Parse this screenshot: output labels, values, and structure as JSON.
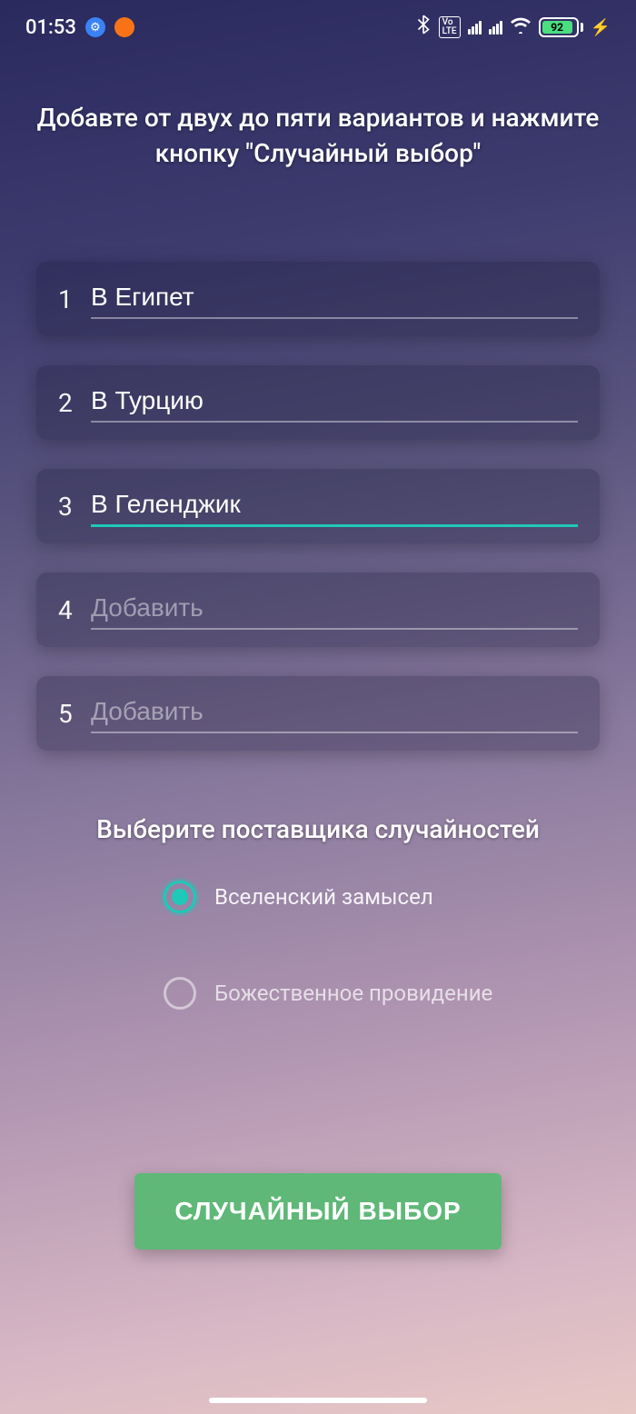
{
  "status": {
    "time": "01:53",
    "battery_pct": "92"
  },
  "instruction": "Добавте от двух до пяти вариантов и нажмите кнопку \"Случайный выбор\"",
  "options": [
    {
      "num": "1",
      "value": "В Египет",
      "placeholder": "",
      "active": false
    },
    {
      "num": "2",
      "value": "В Турцию",
      "placeholder": "",
      "active": false
    },
    {
      "num": "3",
      "value": "В Геленджик",
      "placeholder": "",
      "active": true
    },
    {
      "num": "4",
      "value": "",
      "placeholder": "Добавить",
      "active": false
    },
    {
      "num": "5",
      "value": "",
      "placeholder": "Добавить",
      "active": false
    }
  ],
  "provider_title": "Выберите поставщика случайностей",
  "providers": [
    {
      "label": "Вселенский замысел",
      "selected": true
    },
    {
      "label": "Божественное провидение",
      "selected": false
    }
  ],
  "action_label": "СЛУЧАЙНЫЙ ВЫБОР"
}
